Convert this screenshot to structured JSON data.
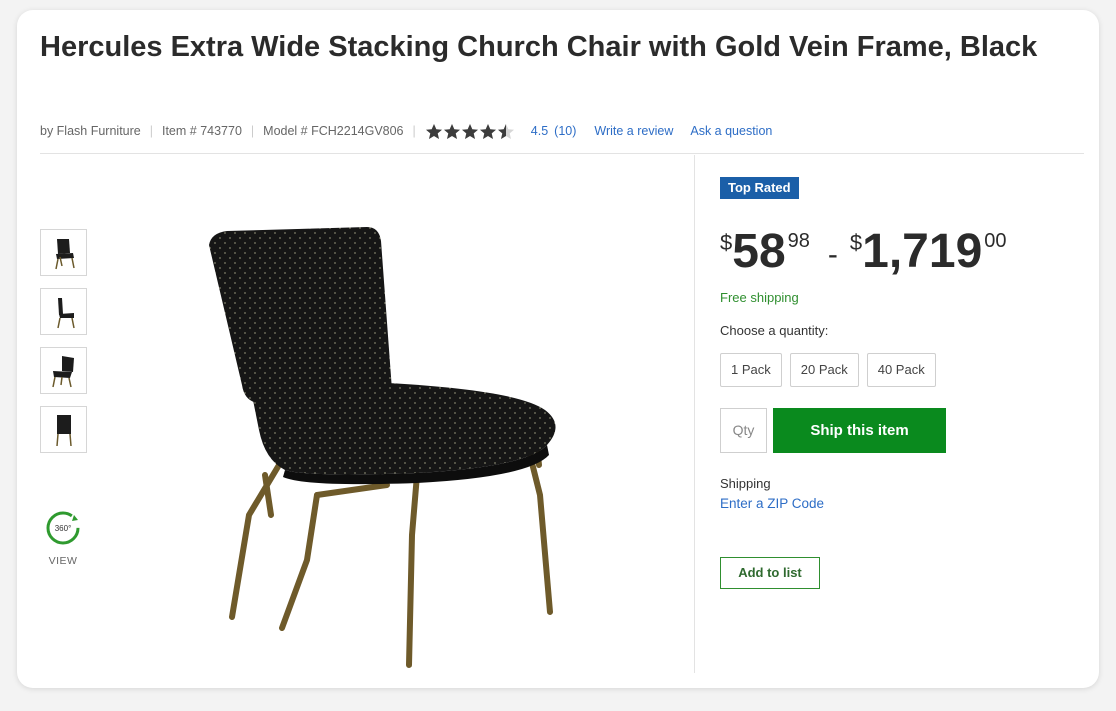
{
  "product": {
    "title": "Hercules Extra Wide Stacking Church Chair with Gold Vein Frame, Black",
    "brand": "by Flash Furniture",
    "item_number": "Item # 743770",
    "model_number": "Model # FCH2214GV806",
    "rating_value": "4.5",
    "rating_count": "(10)",
    "write_review": "Write a review",
    "ask_question": "Ask a question",
    "stars_filled": 4.5,
    "stars_total": 5
  },
  "gallery": {
    "thumbnails": [
      "chair-front-thumbnail",
      "chair-side-thumbnail",
      "chair-angle-thumbnail",
      "chair-back-thumbnail"
    ],
    "view_label": "VIEW",
    "view_icon_text": "360°"
  },
  "buybox": {
    "badge": "Top Rated",
    "price_low": {
      "currency": "$",
      "whole": "58",
      "cents": "98"
    },
    "price_dash": "-",
    "price_high": {
      "currency": "$",
      "whole": "1,719",
      "cents": "00"
    },
    "free_shipping": "Free shipping",
    "choose_quantity": "Choose a quantity:",
    "packs": [
      "1 Pack",
      "20 Pack",
      "40 Pack"
    ],
    "qty_placeholder": "Qty",
    "ship_button": "Ship this item",
    "shipping_label": "Shipping",
    "zip_link": "Enter a ZIP Code",
    "add_to_list": "Add to list"
  },
  "colors": {
    "badge": "#1b5fa8",
    "ship_button": "#0a8a1e",
    "free_shipping": "#2f8f2f",
    "link": "#2d6dc6"
  }
}
